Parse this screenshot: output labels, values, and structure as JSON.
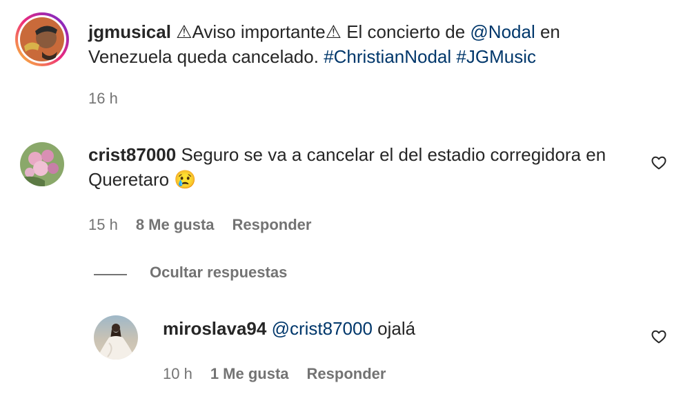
{
  "post": {
    "username": "jgmusical",
    "warn1": "⚠",
    "notice": "Aviso importante",
    "warn2": "⚠",
    "text1": " El concierto de ",
    "mention": "@Nodal",
    "text2": " en Venezuela queda cancelado. ",
    "hashtag1": "#ChristianNodal",
    "hashtag2": "#JGMusic",
    "time": "16 h"
  },
  "comments": [
    {
      "username": "crist87000",
      "text": "Seguro se va a cancelar el del estadio corregidora en Queretaro",
      "emoji": "😢",
      "time": "15 h",
      "likes": "8 Me gusta",
      "reply": "Responder"
    }
  ],
  "thread": {
    "hide_replies": "Ocultar respuestas"
  },
  "replies": [
    {
      "username": "miroslava94",
      "mention": "@crist87000",
      "text": " ojalá",
      "time": "10 h",
      "likes": "1 Me gusta",
      "reply": "Responder"
    }
  ],
  "icons": {
    "like": "heart-outline-icon"
  }
}
